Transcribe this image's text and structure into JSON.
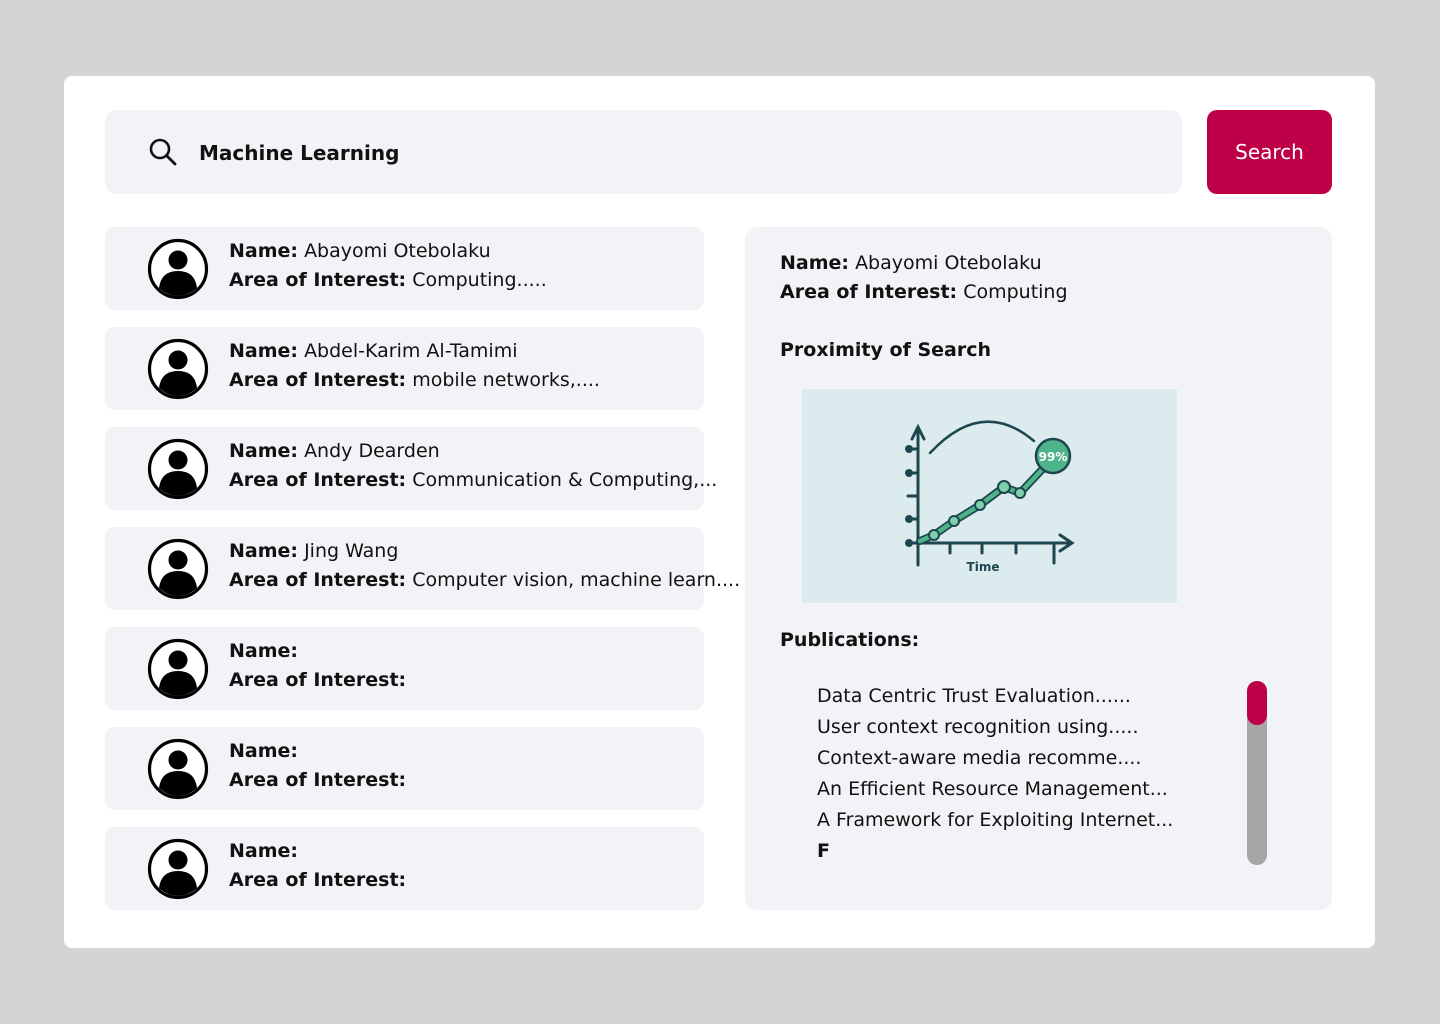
{
  "search": {
    "value": "Machine Learning",
    "button_label": "Search",
    "icon": "search-icon"
  },
  "results": [
    {
      "name_label": "Name:",
      "name": "Abayomi Otebolaku",
      "interest_label": "Area of Interest:",
      "interest": "Computing....."
    },
    {
      "name_label": "Name:",
      "name": "Abdel-Karim Al-Tamimi",
      "interest_label": "Area of Interest:",
      "interest": "mobile networks,...."
    },
    {
      "name_label": "Name:",
      "name": "Andy Dearden",
      "interest_label": "Area of Interest:",
      "interest": "Communication & Computing,..."
    },
    {
      "name_label": "Name:",
      "name": "Jing Wang",
      "interest_label": "Area of Interest:",
      "interest": "Computer vision, machine learn...."
    },
    {
      "name_label": "Name:",
      "name": "",
      "interest_label": "Area of Interest:",
      "interest": ""
    },
    {
      "name_label": "Name:",
      "name": "",
      "interest_label": "Area of Interest:",
      "interest": ""
    },
    {
      "name_label": "Name:",
      "name": "",
      "interest_label": "Area of Interest:",
      "interest": ""
    }
  ],
  "detail": {
    "name_label": "Name:",
    "name": "Abayomi Otebolaku",
    "interest_label": "Area of Interest:",
    "interest": "Computing",
    "proximity_heading": "Proximity of Search",
    "chart": {
      "x_label": "Time",
      "peak_badge": "99%"
    },
    "publications_heading": "Publications:",
    "publications": [
      "Data Centric Trust Evaluation......",
      "User context recognition using.....",
      "Context-aware media recomme....",
      "An Efficient Resource Management...",
      "A Framework for Exploiting Internet...",
      "F"
    ]
  },
  "colors": {
    "accent": "#bd0048",
    "panel": "#f2f3f7",
    "scrollbar_track": "#a6a6a6",
    "background": "#d4d4d4"
  }
}
